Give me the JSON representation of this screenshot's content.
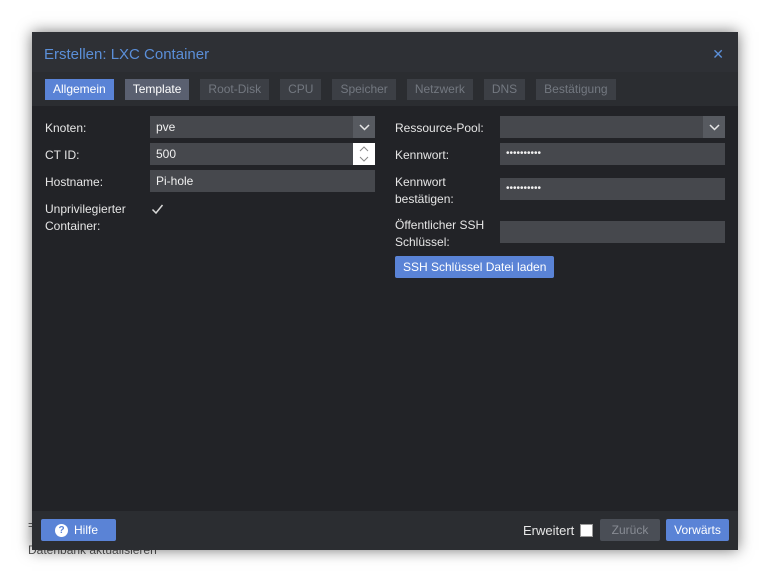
{
  "background": {
    "status_text": "Datenbank aktualisieren",
    "marker": "="
  },
  "dialog": {
    "title": "Erstellen: LXC Container",
    "close_icon": "close-icon"
  },
  "tabs": [
    {
      "label": "Allgemein",
      "state": "active"
    },
    {
      "label": "Template",
      "state": "enabled"
    },
    {
      "label": "Root-Disk",
      "state": "disabled"
    },
    {
      "label": "CPU",
      "state": "disabled"
    },
    {
      "label": "Speicher",
      "state": "disabled"
    },
    {
      "label": "Netzwerk",
      "state": "disabled"
    },
    {
      "label": "DNS",
      "state": "disabled"
    },
    {
      "label": "Bestätigung",
      "state": "disabled"
    }
  ],
  "form": {
    "node_label": "Knoten:",
    "node_value": "pve",
    "ctid_label": "CT ID:",
    "ctid_value": "500",
    "hostname_label": "Hostname:",
    "hostname_value": "Pi-hole",
    "unpriv_label_1": "Unprivilegierter",
    "unpriv_label_2": "Container:",
    "unpriv_checked": true,
    "pool_label": "Ressource-Pool:",
    "pool_value": "",
    "password_label": "Kennwort:",
    "password_value": "••••••••••",
    "confirm_label_1": "Kennwort",
    "confirm_label_2": "bestätigen:",
    "confirm_value": "••••••••••",
    "ssh_label_1": "Öffentlicher SSH",
    "ssh_label_2": "Schlüssel:",
    "ssh_value": "",
    "ssh_button": "SSH Schlüssel Datei laden"
  },
  "footer": {
    "help_button": "Hilfe",
    "advanced_label": "Erweitert",
    "advanced_checked": false,
    "back_button": "Zurück",
    "next_button": "Vorwärts"
  },
  "colors": {
    "accent": "#5a83d6",
    "title": "#5b8fd9",
    "window_bg": "#2b2d31",
    "content_bg": "#222327",
    "field_bg": "#46484d"
  }
}
